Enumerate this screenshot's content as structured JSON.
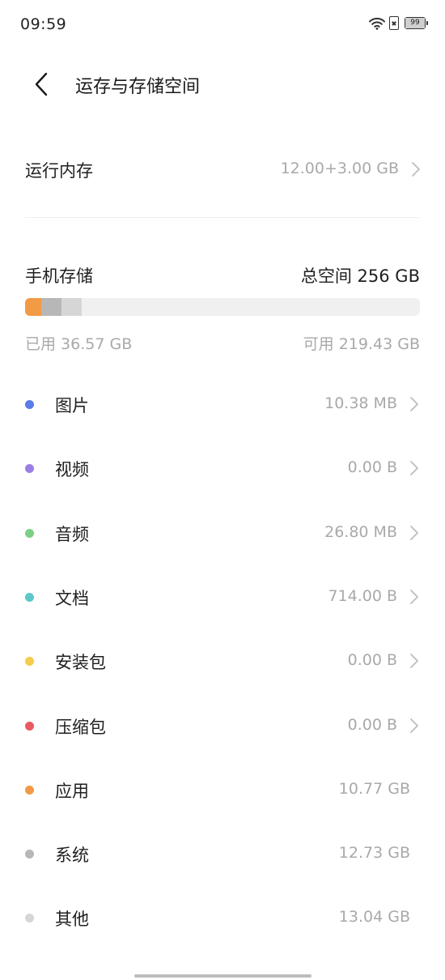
{
  "status_bar": {
    "time": "09:59",
    "battery_level": "99",
    "icons": [
      "wifi-icon",
      "sim-off-icon",
      "battery-icon"
    ]
  },
  "header": {
    "title": "运存与存储空间",
    "back_icon": "chevron-left-icon"
  },
  "memory": {
    "label": "运行内存",
    "value": "12.00+3.00 GB"
  },
  "storage": {
    "title": "手机存储",
    "total": "总空间 256 GB",
    "used": "已用 36.57 GB",
    "available": "可用 219.43 GB",
    "bar_fill_fractions": {
      "apps": 0.042,
      "system": 0.05,
      "other": 0.051
    },
    "bar_colors": {
      "apps": "#f39a45",
      "system": "#b7b7b7",
      "other": "#d6d6d6",
      "track": "#f0f0f0"
    }
  },
  "categories": [
    {
      "label": "图片",
      "value": "10.38 MB",
      "color": "#5a7be8",
      "arrow": true
    },
    {
      "label": "视频",
      "value": "0.00 B",
      "color": "#9a7ee6",
      "arrow": true
    },
    {
      "label": "音频",
      "value": "26.80 MB",
      "color": "#7ccf86",
      "arrow": true
    },
    {
      "label": "文档",
      "value": "714.00 B",
      "color": "#5ec7c9",
      "arrow": true
    },
    {
      "label": "安装包",
      "value": "0.00 B",
      "color": "#f5cb4a",
      "arrow": true
    },
    {
      "label": "压缩包",
      "value": "0.00 B",
      "color": "#e85a62",
      "arrow": true
    },
    {
      "label": "应用",
      "value": "10.77 GB",
      "color": "#f39a45",
      "arrow": false
    },
    {
      "label": "系统",
      "value": "12.73 GB",
      "color": "#b7b7b7",
      "arrow": false
    },
    {
      "label": "其他",
      "value": "13.04 GB",
      "color": "#d6d6d6",
      "arrow": false
    }
  ]
}
